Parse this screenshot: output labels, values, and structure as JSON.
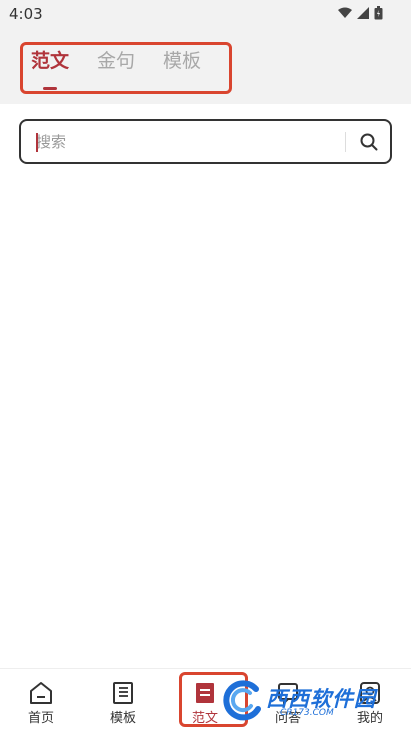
{
  "status_bar": {
    "time": "4:03"
  },
  "top_tabs": {
    "items": [
      {
        "label": "范文",
        "active": true
      },
      {
        "label": "金句",
        "active": false
      },
      {
        "label": "模板",
        "active": false
      }
    ]
  },
  "search": {
    "placeholder": "搜索",
    "value": ""
  },
  "bottom_nav": {
    "items": [
      {
        "label": "首页",
        "icon": "home-icon"
      },
      {
        "label": "模板",
        "icon": "template-icon"
      },
      {
        "label": "范文",
        "icon": "essay-icon",
        "active": true
      },
      {
        "label": "问答",
        "icon": "qa-icon"
      },
      {
        "label": "我的",
        "icon": "profile-icon"
      }
    ]
  },
  "watermark": {
    "text": "西西软件园",
    "sub": "CR173.COM"
  },
  "colors": {
    "accent": "#b0343b",
    "highlight": "#d9452f",
    "watermark": "#1e6fd8"
  }
}
